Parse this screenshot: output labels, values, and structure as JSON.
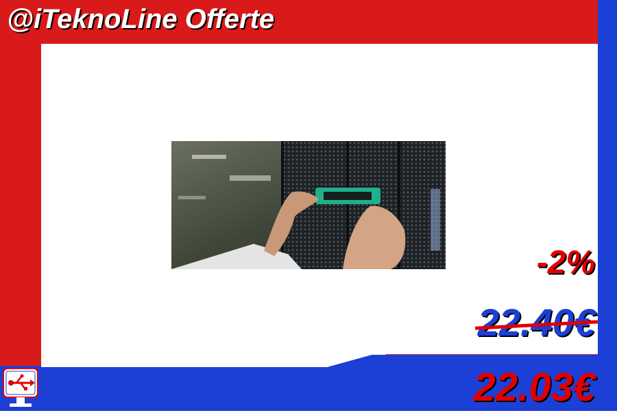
{
  "header": {
    "title": "@iTeknoLine Offerte"
  },
  "product": {
    "image_icon": "server-rack-photo"
  },
  "pricing": {
    "discount": "-2%",
    "old_price": "22.40€",
    "new_price": "22.03€"
  },
  "brand": {
    "logo_icon": "usb-monitor-icon"
  },
  "colors": {
    "red": "#d91a1a",
    "blue": "#1c3fd6",
    "white": "#ffffff"
  }
}
